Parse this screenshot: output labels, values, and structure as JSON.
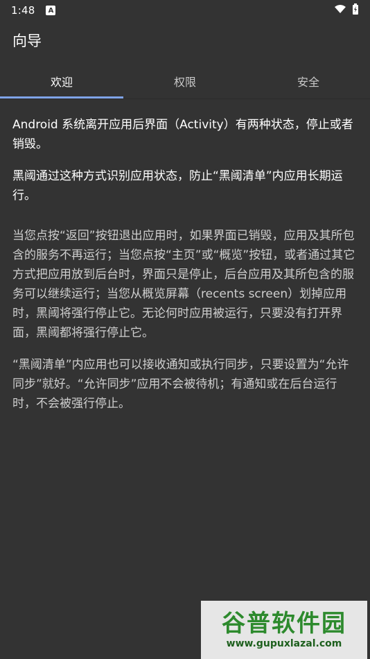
{
  "status_bar": {
    "time": "1:48",
    "notification_glyph": "A",
    "icons": [
      "notification-icon",
      "wifi-icon",
      "battery-icon"
    ]
  },
  "app_bar": {
    "title": "向导"
  },
  "tabs": [
    {
      "label": "欢迎",
      "active": true
    },
    {
      "label": "权限",
      "active": false
    },
    {
      "label": "安全",
      "active": false
    }
  ],
  "content": {
    "paragraphs": [
      "Android 系统离开应用后界面（Activity）有两种状态，停止或者销毁。",
      "黑阈通过这种方式识别应用状态，防止“黑阈清单”内应用长期运行。",
      "当您点按“返回”按钮退出应用时，如果界面已销毁，应用及其所包含的服务不再运行；当您点按“主页”或“概览”按钮，或者通过其它方式把应用放到后台时，界面只是停止，后台应用及其所包含的服务可以继续运行；当您从概览屏幕（recents screen）划掉应用时，黑阈将强行停止它。无论何时应用被运行，只要没有打开界面，黑阈都将强行停止它。",
      "“黑阈清单”内应用也可以接收通知或执行同步，只要设置为“允许同步”就好。“允许同步”应用不会被待机；有通知或在后台运行时，不会被强行停止。"
    ]
  },
  "watermark": {
    "title": "谷普软件园",
    "url": "www.gupuxlazal.com"
  },
  "colors": {
    "background": "#333333",
    "tab_indicator": "#7fa3e8",
    "text_primary": "#ffffff",
    "text_secondary": "#cfcfcf"
  }
}
